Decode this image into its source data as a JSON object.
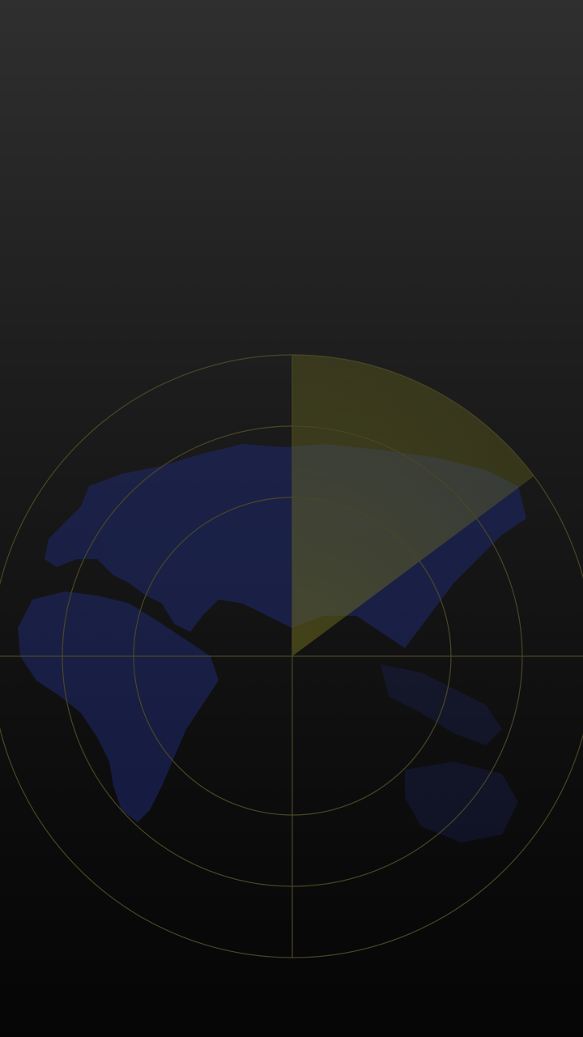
{
  "screen": {
    "background_top": "#2f2f2f",
    "background_bottom": "#050505"
  },
  "radar": {
    "ring_color": "#4a4626",
    "sweep_color": "#6b6a1e",
    "land_color": "#1f2a6e",
    "sweep_icon": "radar-sweep",
    "map_icon": "world-map"
  }
}
